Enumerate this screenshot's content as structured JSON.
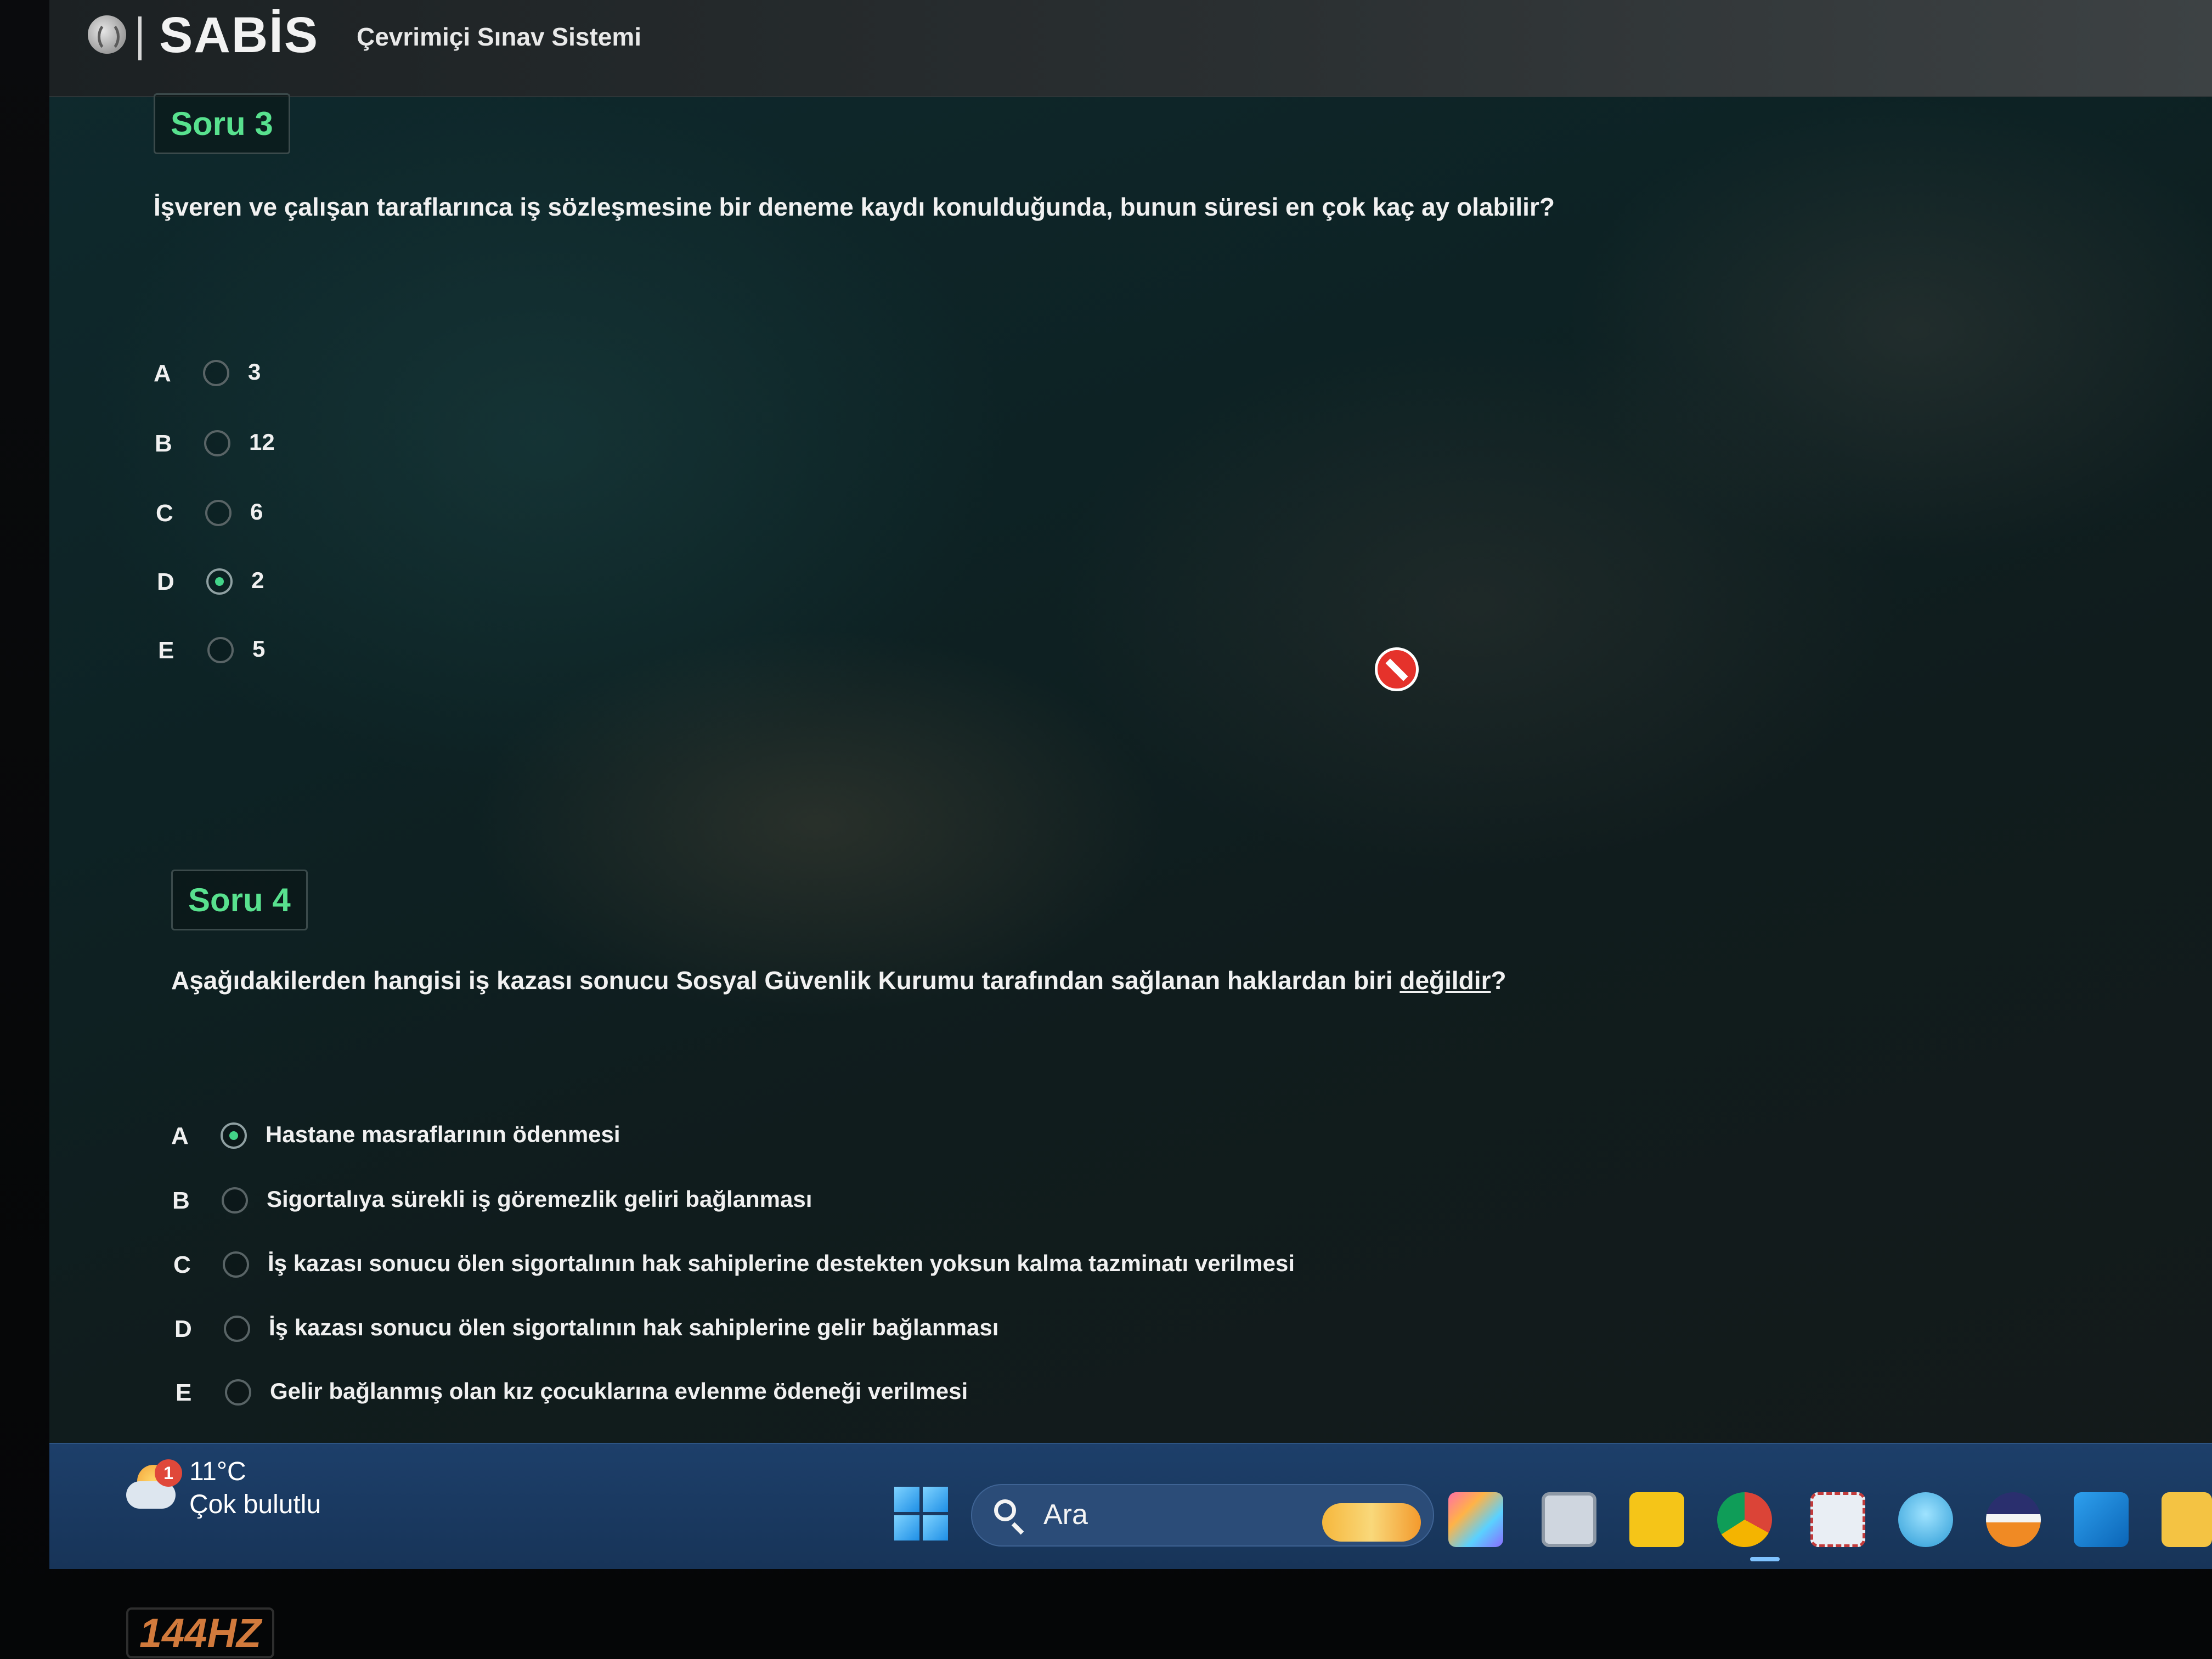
{
  "header": {
    "logo_text": "SABİS",
    "subtitle": "Çevrimiçi Sınav Sistemi"
  },
  "questions": [
    {
      "badge": "Soru 3",
      "text": "İşveren ve çalışan taraflarınca iş sözleşmesine bir deneme kaydı konulduğunda, bunun süresi en çok kaç ay olabilir?",
      "options": [
        {
          "letter": "A",
          "label": "3",
          "selected": false
        },
        {
          "letter": "B",
          "label": "12",
          "selected": false
        },
        {
          "letter": "C",
          "label": "6",
          "selected": false
        },
        {
          "letter": "D",
          "label": "2",
          "selected": true
        },
        {
          "letter": "E",
          "label": "5",
          "selected": false
        }
      ]
    },
    {
      "badge": "Soru 4",
      "text_before": "Aşağıdakilerden hangisi iş kazası sonucu Sosyal Güvenlik Kurumu tarafından sağlanan haklardan biri ",
      "text_underlined": "değildir",
      "text_after": "?",
      "options": [
        {
          "letter": "A",
          "label": "Hastane masraflarının ödenmesi",
          "selected": true
        },
        {
          "letter": "B",
          "label": "Sigortalıya sürekli iş göremezlik geliri bağlanması",
          "selected": false
        },
        {
          "letter": "C",
          "label": "İş kazası sonucu ölen sigortalının hak sahiplerine destekten yoksun kalma tazminatı verilmesi",
          "selected": false
        },
        {
          "letter": "D",
          "label": "İş kazası sonucu ölen sigortalının hak sahiplerine gelir bağlanması",
          "selected": false
        },
        {
          "letter": "E",
          "label": "Gelir bağlanmış olan kız çocuklarına evlenme ödeneği verilmesi",
          "selected": false
        }
      ]
    }
  ],
  "taskbar": {
    "weather_badge": "1",
    "weather_temp": "11°C",
    "weather_desc": "Çok bulutlu",
    "search_label": "Ara"
  },
  "monitor": {
    "refresh_label": "144HZ"
  },
  "colors": {
    "accent_green": "#58e18e",
    "taskbar_blue": "#1d3f6a"
  }
}
